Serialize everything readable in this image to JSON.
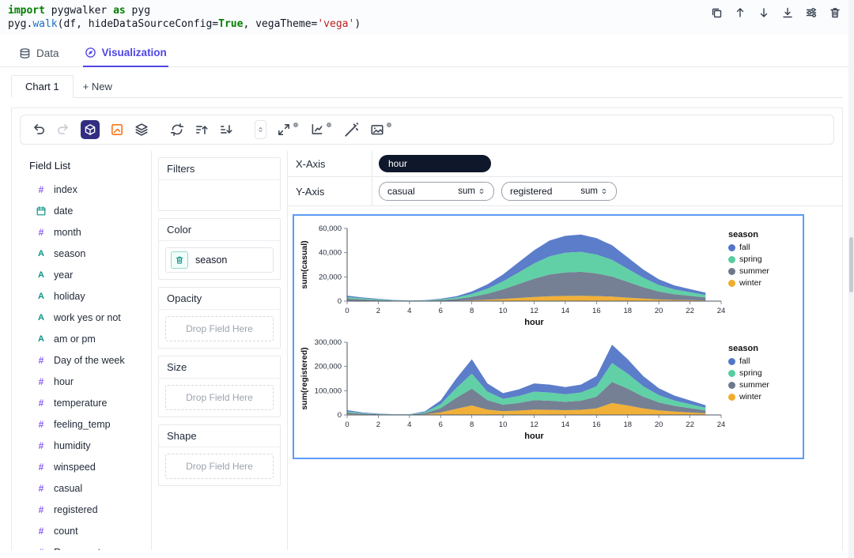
{
  "code": {
    "line1": {
      "kw1": "import",
      "name1": " pygwalker ",
      "kw2": "as",
      "name2": " pyg"
    },
    "line2": {
      "obj": "pyg",
      "dot": ".",
      "fn": "walk",
      "args1": "(df, hideDataSourceConfig=",
      "bool": "True",
      "args2": ", vegaTheme=",
      "str": "'vega'",
      "close": ")"
    }
  },
  "header_actions": [
    {
      "name": "copy"
    },
    {
      "name": "move-up"
    },
    {
      "name": "move-down"
    },
    {
      "name": "download"
    },
    {
      "name": "settings"
    },
    {
      "name": "delete"
    }
  ],
  "tabs": {
    "data": "Data",
    "visualization": "Visualization"
  },
  "chart_tabs": {
    "active": "Chart 1",
    "new_tab": "+ New"
  },
  "toolbar": {
    "items": [
      {
        "name": "undo"
      },
      {
        "name": "redo",
        "disabled": true
      },
      {
        "name": "tile-mode",
        "active": true
      },
      {
        "name": "mark-type"
      },
      {
        "name": "layers"
      },
      {
        "name": "refresh",
        "group_start": true
      },
      {
        "name": "sort-ascending"
      },
      {
        "name": "sort-descending"
      },
      {
        "name": "zoom-stepper",
        "group_start": true
      },
      {
        "name": "resize",
        "gear": true
      },
      {
        "name": "coordinate-system",
        "gear": true
      },
      {
        "name": "magic-wand"
      },
      {
        "name": "export-image",
        "gear": true
      }
    ]
  },
  "field_list": {
    "title": "Field List",
    "items": [
      {
        "name": "index",
        "type": "quantitative"
      },
      {
        "name": "date",
        "type": "temporal"
      },
      {
        "name": "month",
        "type": "quantitative"
      },
      {
        "name": "season",
        "type": "nominal"
      },
      {
        "name": "year",
        "type": "nominal"
      },
      {
        "name": "holiday",
        "type": "nominal"
      },
      {
        "name": "work yes or not",
        "type": "nominal"
      },
      {
        "name": "am or pm",
        "type": "nominal"
      },
      {
        "name": "Day of the week",
        "type": "quantitative"
      },
      {
        "name": "hour",
        "type": "quantitative"
      },
      {
        "name": "temperature",
        "type": "quantitative"
      },
      {
        "name": "feeling_temp",
        "type": "quantitative"
      },
      {
        "name": "humidity",
        "type": "quantitative"
      },
      {
        "name": "winspeed",
        "type": "quantitative"
      },
      {
        "name": "casual",
        "type": "quantitative"
      },
      {
        "name": "registered",
        "type": "quantitative"
      },
      {
        "name": "count",
        "type": "quantitative"
      },
      {
        "name": "Row count",
        "type": "quantitative"
      }
    ]
  },
  "encodings": {
    "filters_label": "Filters",
    "color_label": "Color",
    "color_field": "season",
    "opacity_label": "Opacity",
    "size_label": "Size",
    "shape_label": "Shape",
    "drop_placeholder": "Drop Field Here"
  },
  "axes": {
    "x_label": "X-Axis",
    "x_field": "hour",
    "y_label": "Y-Axis",
    "y_fields": [
      {
        "field": "casual",
        "agg": "sum"
      },
      {
        "field": "registered",
        "agg": "sum"
      }
    ]
  },
  "colors": {
    "accent": "#4f46e5",
    "chart_border": "#5b9cf6",
    "measure": "#8b5cf6",
    "dimension": "#0d9488",
    "tile_bg": "#312e81",
    "mark_orange": "#f97316",
    "fall": "#5276c7",
    "spring": "#58cda1",
    "summer": "#6e798e",
    "winter": "#f0ad2d"
  },
  "chart_data": [
    {
      "type": "area",
      "stacked": true,
      "x": [
        0,
        1,
        2,
        3,
        4,
        5,
        6,
        7,
        8,
        9,
        10,
        11,
        12,
        13,
        14,
        15,
        16,
        17,
        18,
        19,
        20,
        21,
        22,
        23
      ],
      "xlim": [
        0,
        24
      ],
      "ylim": [
        0,
        60000
      ],
      "x_ticks": [
        0,
        2,
        4,
        6,
        8,
        10,
        12,
        14,
        16,
        18,
        20,
        22,
        24
      ],
      "y_ticks": [
        0,
        20000,
        40000,
        60000
      ],
      "xlabel": "hour",
      "ylabel": "sum(casual)",
      "legend_title": "season",
      "stack_order": [
        "winter",
        "summer",
        "spring",
        "fall"
      ],
      "series": [
        {
          "name": "fall",
          "color": "#5276c7",
          "values": [
            1150,
            780,
            520,
            260,
            160,
            210,
            520,
            1040,
            2100,
            3600,
            5700,
            8300,
            10900,
            13000,
            14000,
            14300,
            13500,
            12000,
            9400,
            6800,
            4700,
            3400,
            2600,
            1800
          ]
        },
        {
          "name": "spring",
          "color": "#58cda1",
          "values": [
            1350,
            900,
            600,
            300,
            180,
            240,
            600,
            1200,
            2400,
            4200,
            6600,
            9600,
            12600,
            15000,
            16200,
            16500,
            15600,
            13800,
            10800,
            7800,
            5400,
            3900,
            3000,
            2100
          ]
        },
        {
          "name": "summer",
          "color": "#6e798e",
          "values": [
            1600,
            1100,
            700,
            360,
            220,
            290,
            720,
            1440,
            2900,
            5000,
            7900,
            11500,
            15100,
            18000,
            19400,
            19800,
            18700,
            16600,
            13000,
            9400,
            6500,
            4700,
            3600,
            2500
          ]
        },
        {
          "name": "winter",
          "color": "#f0ad2d",
          "values": [
            400,
            250,
            150,
            80,
            50,
            60,
            160,
            320,
            640,
            1100,
            1800,
            2600,
            3400,
            4000,
            4300,
            4400,
            4200,
            3700,
            2900,
            2100,
            1400,
            1000,
            800,
            550
          ]
        }
      ]
    },
    {
      "type": "area",
      "stacked": true,
      "x": [
        0,
        1,
        2,
        3,
        4,
        5,
        6,
        7,
        8,
        9,
        10,
        11,
        12,
        13,
        14,
        15,
        16,
        17,
        18,
        19,
        20,
        21,
        22,
        23
      ],
      "xlim": [
        0,
        24
      ],
      "ylim": [
        0,
        300000
      ],
      "x_ticks": [
        0,
        2,
        4,
        6,
        8,
        10,
        12,
        14,
        16,
        18,
        20,
        22,
        24
      ],
      "y_ticks": [
        0,
        100000,
        200000,
        300000
      ],
      "xlabel": "hour",
      "ylabel": "sum(registered)",
      "legend_title": "season",
      "stack_order": [
        "winter",
        "summer",
        "spring",
        "fall"
      ],
      "series": [
        {
          "name": "fall",
          "color": "#5276c7",
          "values": [
            5200,
            2600,
            1600,
            800,
            800,
            3900,
            15600,
            39000,
            59800,
            33800,
            23400,
            27300,
            33800,
            32500,
            29900,
            32500,
            41600,
            75400,
            59800,
            41600,
            28600,
            20800,
            15600,
            10400
          ]
        },
        {
          "name": "spring",
          "color": "#58cda1",
          "values": [
            5400,
            2700,
            1600,
            800,
            800,
            4100,
            16200,
            40500,
            62100,
            35100,
            24300,
            28400,
            35100,
            33800,
            31100,
            33800,
            43200,
            78300,
            62100,
            43200,
            29700,
            21600,
            16200,
            10800
          ]
        },
        {
          "name": "summer",
          "color": "#6e798e",
          "values": [
            6000,
            3000,
            1800,
            900,
            900,
            4500,
            18000,
            45000,
            69000,
            39000,
            27000,
            31500,
            39000,
            37500,
            34500,
            37500,
            48000,
            87000,
            69000,
            48000,
            33000,
            24000,
            18000,
            12000
          ]
        },
        {
          "name": "winter",
          "color": "#f0ad2d",
          "values": [
            3400,
            1700,
            1000,
            500,
            500,
            2600,
            10200,
            25500,
            39100,
            22100,
            15300,
            17900,
            22100,
            21300,
            19600,
            21300,
            27200,
            49300,
            39100,
            27200,
            18700,
            13600,
            10200,
            6800
          ]
        }
      ]
    }
  ]
}
